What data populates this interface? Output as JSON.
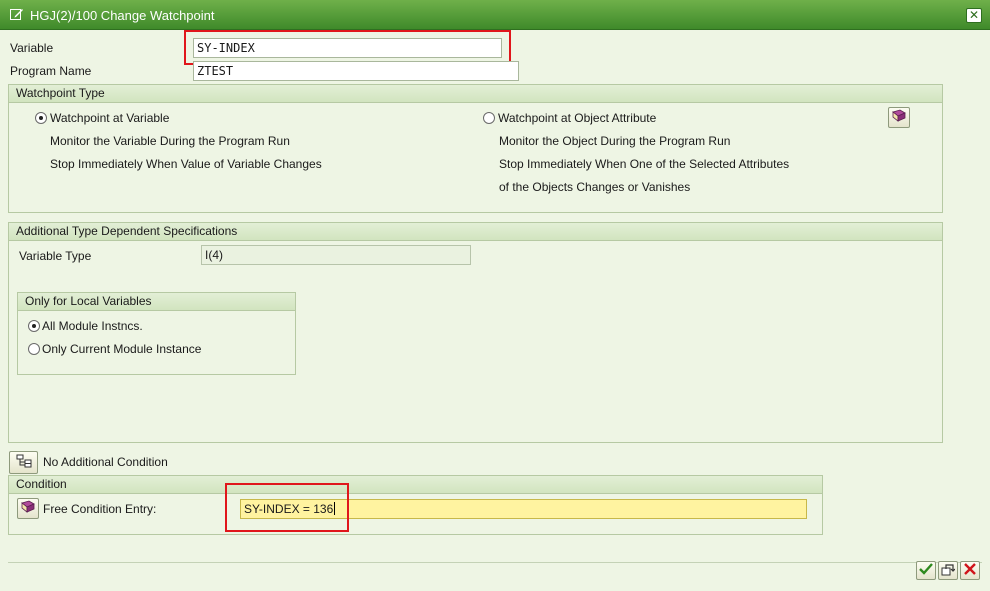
{
  "window": {
    "title": "HGJ(2)/100 Change Watchpoint",
    "close_icon": "close-icon"
  },
  "variable": {
    "label": "Variable",
    "value": "SY-INDEX"
  },
  "program": {
    "label": "Program Name",
    "value": "ZTEST"
  },
  "watchpoint_type": {
    "header": "Watchpoint Type",
    "option_variable": {
      "label": "Watchpoint at Variable",
      "selected": true,
      "desc1": "Monitor the Variable During the Program Run",
      "desc2": "Stop Immediately When Value of Variable Changes"
    },
    "option_object": {
      "label": "Watchpoint at Object Attribute",
      "selected": false,
      "desc1": "Monitor the Object During the Program Run",
      "desc2": "Stop Immediately When One of the Selected Attributes",
      "desc3": "of the Objects Changes or Vanishes"
    }
  },
  "additional": {
    "header": "Additional Type Dependent Specifications",
    "variable_type_label": "Variable Type",
    "variable_type_value": "I(4)",
    "local": {
      "header": "Only for Local Variables",
      "option_all": {
        "label": "All Module Instncs.",
        "selected": true
      },
      "option_current": {
        "label": "Only Current Module Instance",
        "selected": false
      }
    }
  },
  "condition_toggle": {
    "label": "No Additional Condition"
  },
  "condition": {
    "header": "Condition",
    "free_label": "Free Condition Entry:",
    "free_value": "SY-INDEX = 136"
  },
  "colors": {
    "title_bar": "#3f8a2a",
    "highlight_box": "#e0161b",
    "input_yellow": "#fff3a0"
  }
}
